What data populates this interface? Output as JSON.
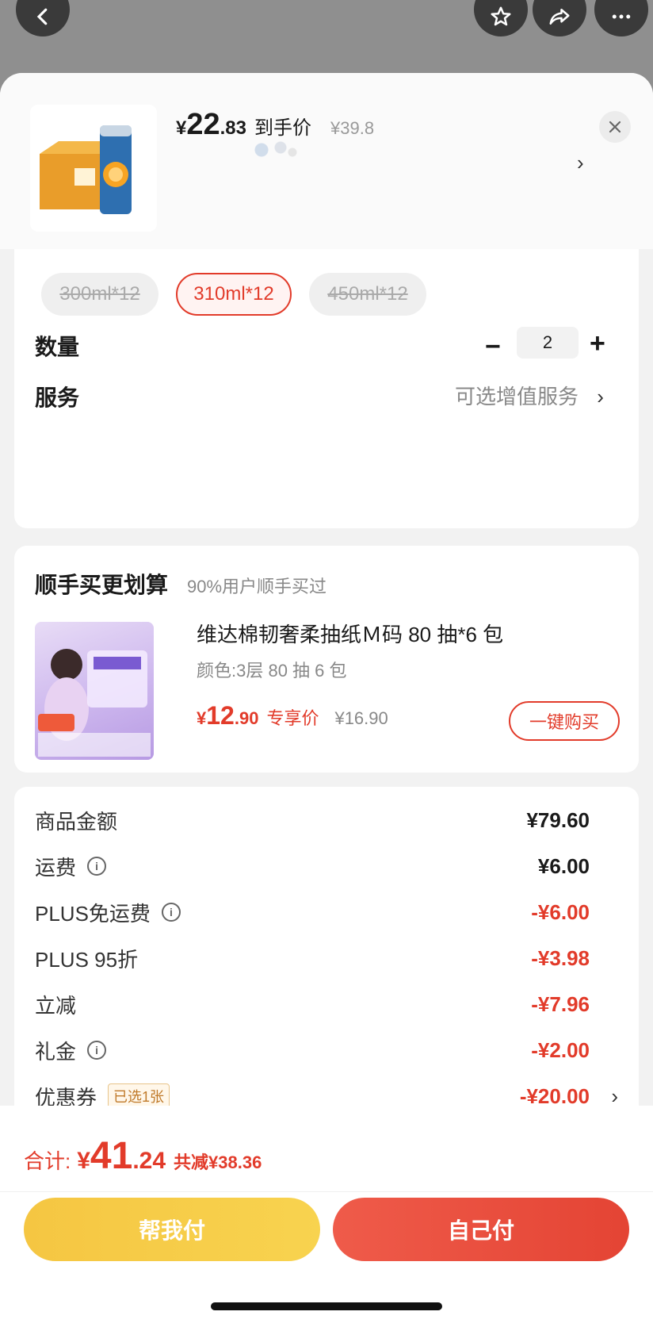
{
  "product": {
    "price_symbol": "¥",
    "price_int": "22",
    "price_dec": ".83",
    "price_tag": "到手价",
    "original_price": "¥39.8"
  },
  "specs": [
    {
      "label": "300ml*12",
      "state": "unavailable"
    },
    {
      "label": "310ml*12",
      "state": "selected"
    },
    {
      "label": "450ml*12",
      "state": "unavailable"
    }
  ],
  "quantity": {
    "label": "数量",
    "value": "2"
  },
  "service": {
    "label": "服务",
    "value": "可选增值服务"
  },
  "addon": {
    "title": "顺手买更划算",
    "subtitle": "90%用户顺手买过",
    "name": "维达棉韧奢柔抽纸Ｍ码 80 抽*6 包",
    "spec": "颜色:3层 80 抽 6 包",
    "price_symbol": "¥",
    "price_int": "12",
    "price_dec": ".90",
    "price_tag": "专享价",
    "original_price": "¥16.90",
    "buy_label": "一键购买"
  },
  "summary": [
    {
      "label": "商品金额",
      "value": "¥79.60",
      "info": false,
      "red": false
    },
    {
      "label": "运费",
      "value": "¥6.00",
      "info": true,
      "red": false
    },
    {
      "label": "PLUS免运费",
      "value": "-¥6.00",
      "info": true,
      "red": true
    },
    {
      "label": "PLUS 95折",
      "value": "-¥3.98",
      "info": false,
      "red": true
    },
    {
      "label": "立减",
      "value": "-¥7.96",
      "info": false,
      "red": true
    },
    {
      "label": "礼金",
      "value": "-¥2.00",
      "info": true,
      "red": true
    },
    {
      "label": "优惠券",
      "value": "-¥20.00",
      "info": false,
      "red": true,
      "badge": "已选1张"
    }
  ],
  "footer": {
    "total_label": "合计:",
    "total_symbol": "¥",
    "total_int": "41",
    "total_dec": ".24",
    "total_saved": "共减¥38.36",
    "help_pay": "帮我付",
    "self_pay": "自己付"
  },
  "colors": {
    "accent": "#e23b2a",
    "help_pay": "#f5c642",
    "self_pay": "#e44434"
  }
}
